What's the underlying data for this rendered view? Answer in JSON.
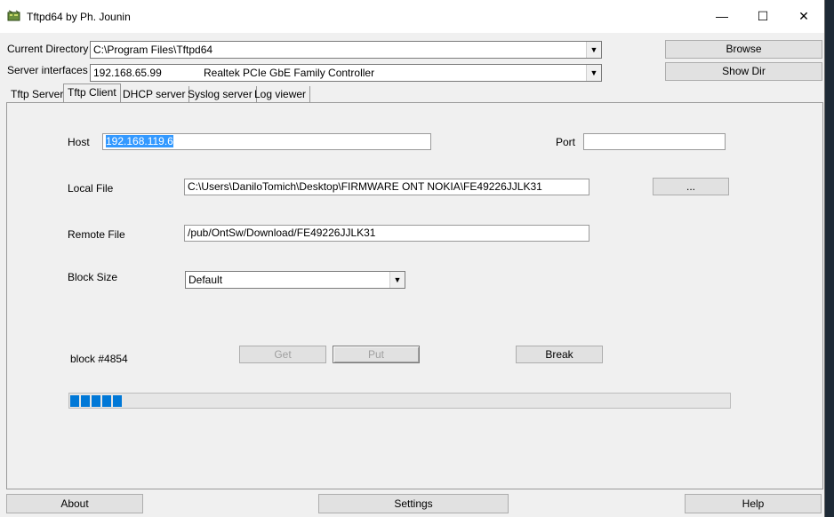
{
  "window": {
    "title": "Tftpd64 by Ph. Jounin",
    "controls": {
      "minimize": "—",
      "maximize": "☐",
      "close": "✕"
    }
  },
  "header": {
    "current_dir_label": "Current Directory",
    "current_dir_value": "C:\\Program Files\\Tftpd64",
    "server_if_label": "Server interfaces",
    "server_if_ip": "192.168.65.99",
    "server_if_adapter": "Realtek PCIe GbE Family Controller",
    "browse_label": "Browse",
    "showdir_label": "Show Dir"
  },
  "tabs": [
    {
      "label": "Tftp Server"
    },
    {
      "label": "Tftp Client"
    },
    {
      "label": "DHCP server"
    },
    {
      "label": "Syslog server"
    },
    {
      "label": "Log viewer"
    }
  ],
  "client": {
    "host_label": "Host",
    "host_value": "192.168.119.6",
    "port_label": "Port",
    "port_value": "",
    "local_file_label": "Local File",
    "local_file_value": "C:\\Users\\DaniloTomich\\Desktop\\FIRMWARE ONT NOKIA\\FE49226JJLK31",
    "browse_file_label": "...",
    "remote_file_label": "Remote File",
    "remote_file_value": "/pub/OntSw/Download/FE49226JJLK31",
    "block_size_label": "Block Size",
    "block_size_value": "Default",
    "status_text": "block #4854",
    "get_label": "Get",
    "put_label": "Put",
    "break_label": "Break",
    "progress_chunks": 5
  },
  "footer": {
    "about_label": "About",
    "settings_label": "Settings",
    "help_label": "Help"
  },
  "colors": {
    "accent": "#0078d7",
    "selection": "#3399ff"
  }
}
